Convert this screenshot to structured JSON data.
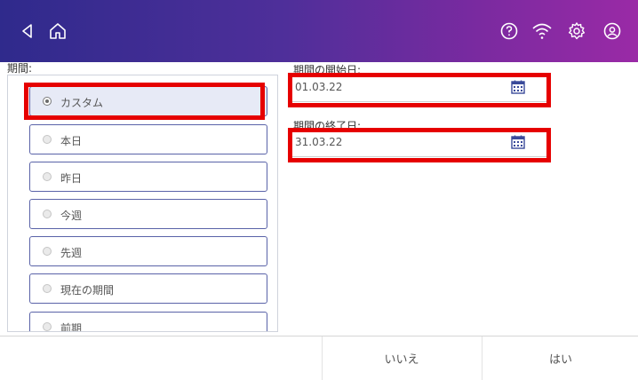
{
  "header": {
    "back_icon": "back-triangle-icon",
    "home_icon": "home-icon",
    "help_icon": "help-icon",
    "wifi_icon": "wifi-icon",
    "settings_icon": "gear-icon",
    "account_icon": "account-icon",
    "gradient_colors": [
      "#2f2a8c",
      "#9a2aa6"
    ]
  },
  "period": {
    "label": "期間:",
    "options": [
      {
        "label": "カスタム",
        "selected": true
      },
      {
        "label": "本日",
        "selected": false
      },
      {
        "label": "昨日",
        "selected": false
      },
      {
        "label": "今週",
        "selected": false
      },
      {
        "label": "先週",
        "selected": false
      },
      {
        "label": "現在の期間",
        "selected": false
      },
      {
        "label": "前期",
        "selected": false
      }
    ]
  },
  "start_date": {
    "label": "期間の開始日:",
    "value": "01.03.22",
    "icon": "calendar-icon"
  },
  "end_date": {
    "label": "期間の終了日:",
    "value": "31.03.22",
    "icon": "calendar-icon"
  },
  "footer": {
    "no_label": "いいえ",
    "yes_label": "はい"
  },
  "highlight_color": "#e60000"
}
